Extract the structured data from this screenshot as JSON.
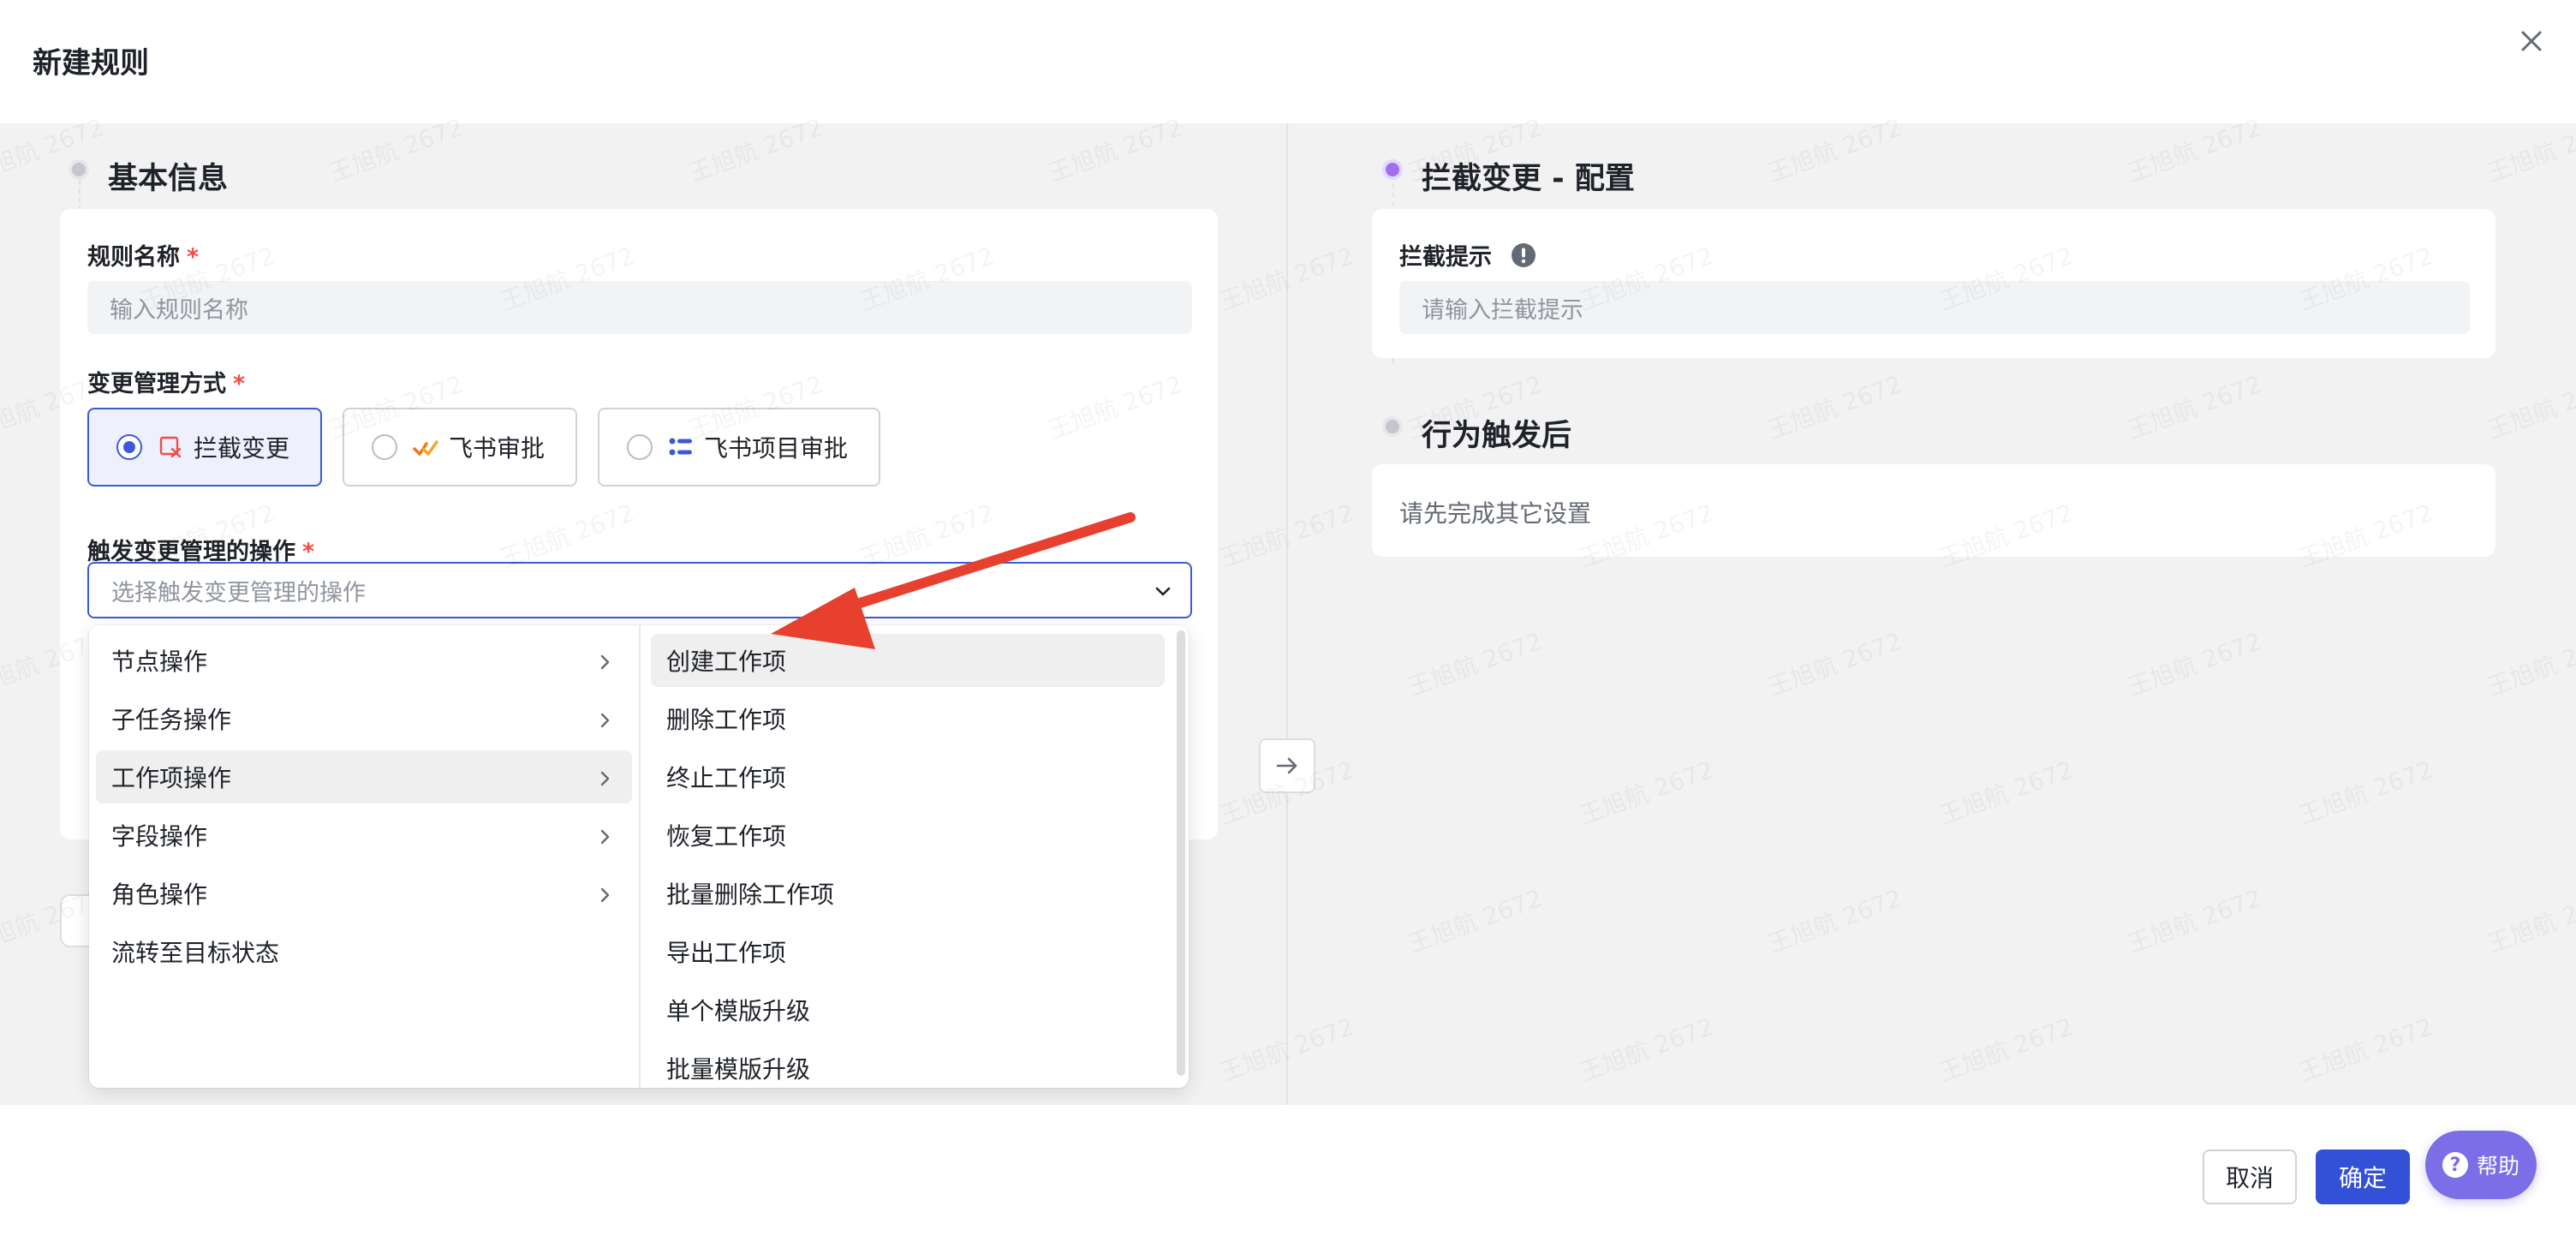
{
  "header": {
    "title": "新建规则"
  },
  "left": {
    "section_title": "基本信息",
    "rule_name": {
      "label": "规则名称",
      "required": "*",
      "placeholder": "输入规则名称"
    },
    "mode": {
      "label": "变更管理方式",
      "required": "*",
      "options": [
        {
          "label": "拦截变更",
          "icon": "intercept-icon",
          "selected": true
        },
        {
          "label": "飞书审批",
          "icon": "feishu-approval-icon",
          "selected": false
        },
        {
          "label": "飞书项目审批",
          "icon": "feishu-project-approval-icon",
          "selected": false
        }
      ]
    },
    "trigger": {
      "label": "触发变更管理的操作",
      "required": "*",
      "placeholder": "选择触发变更管理的操作"
    }
  },
  "dropdown": {
    "categories": [
      {
        "label": "节点操作",
        "has_children": true
      },
      {
        "label": "子任务操作",
        "has_children": true
      },
      {
        "label": "工作项操作",
        "has_children": true,
        "active": true
      },
      {
        "label": "字段操作",
        "has_children": true
      },
      {
        "label": "角色操作",
        "has_children": true
      },
      {
        "label": "流转至目标状态",
        "has_children": false
      }
    ],
    "actions": [
      {
        "label": "创建工作项",
        "active": true
      },
      {
        "label": "删除工作项"
      },
      {
        "label": "终止工作项"
      },
      {
        "label": "恢复工作项"
      },
      {
        "label": "批量删除工作项"
      },
      {
        "label": "导出工作项"
      },
      {
        "label": "单个模版升级"
      },
      {
        "label": "批量模版升级"
      }
    ]
  },
  "right": {
    "section1_title": "拦截变更 - 配置",
    "tip": {
      "label": "拦截提示",
      "placeholder": "请输入拦截提示"
    },
    "section2_title": "行为触发后",
    "pending_text": "请先完成其它设置"
  },
  "footer": {
    "cancel": "取消",
    "confirm": "确定",
    "help": "帮助"
  },
  "watermark": "王旭航 2672",
  "colors": {
    "primary": "#3251d6",
    "accent_purple": "#9f6ff0",
    "help_purple": "#7b6ee6",
    "required": "#f54a45",
    "annotation_arrow": "#e8402f"
  }
}
